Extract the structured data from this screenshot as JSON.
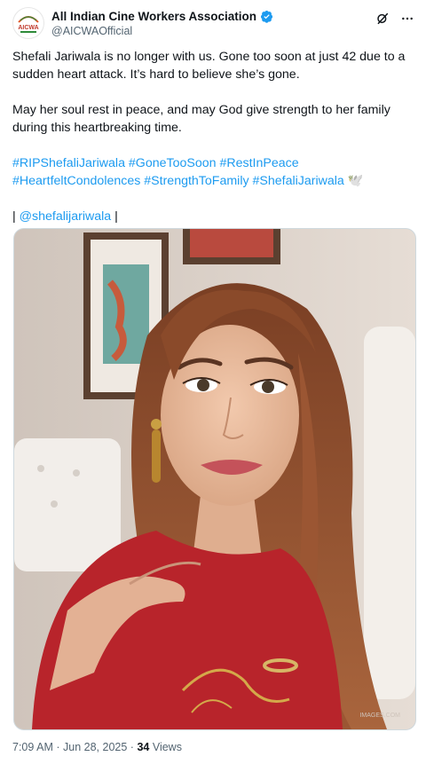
{
  "account": {
    "display_name": "All Indian Cine Workers Association",
    "handle": "@AICWAOfficial",
    "avatar_logo_text": "AICWA"
  },
  "tweet": {
    "paragraph1": "Shefali Jariwala is no longer with us. Gone too soon at just 42 due to a sudden heart attack. It’s hard to believe she’s gone.",
    "paragraph2": "May her soul rest in peace, and may God give strength to her family during this heartbreaking time.",
    "hashtags_line1": [
      "#RIPShefaliJariwala",
      "#GoneTooSoon",
      "#RestInPeace"
    ],
    "hashtags_line2": [
      "#HeartfeltCondolences",
      "#StrengthToFamily",
      "#ShefaliJariwala"
    ],
    "dove_emoji": "🕊️",
    "mention_prefix": "|",
    "mention": "@shefalijariwala",
    "mention_suffix": "|"
  },
  "media": {
    "watermark": "IMAGES.COM"
  },
  "meta": {
    "time": "7:09 AM",
    "separator": "·",
    "date": "Jun 28, 2025",
    "views_count": "34",
    "views_label": "Views"
  },
  "icons": {
    "verified": "verified-badge-icon",
    "grok": "grok-icon",
    "more": "more-icon"
  },
  "colors": {
    "link": "#1d9bf0",
    "verified": "#1d9bf0",
    "secondary_text": "#536471"
  }
}
